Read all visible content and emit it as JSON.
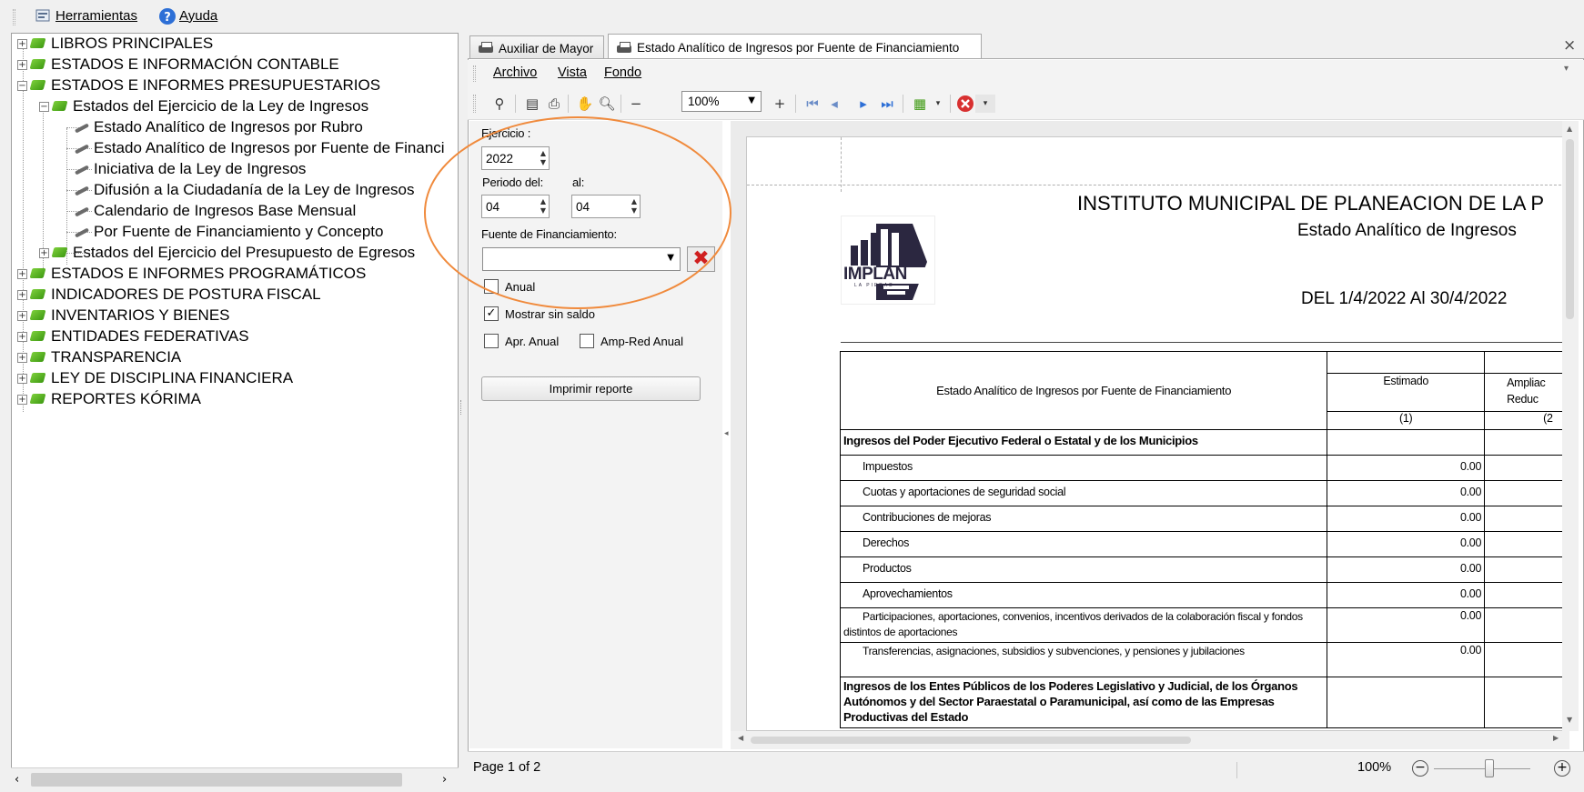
{
  "top_menu": {
    "tools": "Herramientas",
    "help": "Ayuda"
  },
  "tree": {
    "items": [
      {
        "label": "LIBROS PRINCIPALES"
      },
      {
        "label": "ESTADOS E INFORMACIÓN CONTABLE"
      },
      {
        "label": "ESTADOS E INFORMES PRESUPUESTARIOS"
      },
      {
        "label": "Estados del Ejercicio de la Ley de Ingresos"
      },
      {
        "label": "Estado Analítico de Ingresos por Rubro"
      },
      {
        "label": "Estado Analítico de Ingresos por Fuente de Financi"
      },
      {
        "label": "Iniciativa de la Ley de Ingresos"
      },
      {
        "label": "Difusión a la Ciudadanía de la Ley de Ingresos"
      },
      {
        "label": "Calendario de Ingresos Base Mensual"
      },
      {
        "label": "Por Fuente de Financiamiento y Concepto"
      },
      {
        "label": "Estados del Ejercicio del Presupuesto de Egresos"
      },
      {
        "label": "ESTADOS E INFORMES PROGRAMÁTICOS"
      },
      {
        "label": "INDICADORES DE POSTURA FISCAL"
      },
      {
        "label": "INVENTARIOS Y BIENES"
      },
      {
        "label": "ENTIDADES FEDERATIVAS"
      },
      {
        "label": "TRANSPARENCIA"
      },
      {
        "label": "LEY DE DISCIPLINA FINANCIERA"
      },
      {
        "label": "REPORTES KÓRIMA"
      }
    ]
  },
  "tabs": [
    {
      "label": "Auxiliar de Mayor"
    },
    {
      "label": "Estado Analítico de Ingresos por Fuente de Financiamiento"
    }
  ],
  "doc_menu": {
    "file": "Archivo",
    "view": "Vista",
    "bg": "Fondo"
  },
  "toolbar": {
    "zoom": "100%"
  },
  "params": {
    "ejercicio_label": "Ejercicio :",
    "ejercicio": "2022",
    "periodo_label": "Periodo del:",
    "al_label": "al:",
    "periodo_del": "04",
    "periodo_al": "04",
    "fuente_label": "Fuente de Financiamiento:",
    "fuente_value": "",
    "anual": "Anual",
    "mostrar": "Mostrar sin saldo",
    "apr_anual": "Apr. Anual",
    "amp_anual": "Amp-Red Anual",
    "print": "Imprimir reporte"
  },
  "report": {
    "institute": "INSTITUTO MUNICIPAL DE PLANEACION DE LA P",
    "subtitle": "Estado Analítico de Ingresos",
    "period": "DEL 1/4/2022 Al 30/4/2022",
    "logo_text": "IMPLAN",
    "logo_sub": "LA PIEDAD",
    "table": {
      "header_title": "Estado Analítico de Ingresos por Fuente de Financiamiento",
      "col1": "Estimado",
      "col1_num": "(1)",
      "col2a": "Ampliac",
      "col2b": "Reduc",
      "col2_num": "(2",
      "section1": "Ingresos del Poder Ejecutivo Federal o Estatal y de los Municipios",
      "rows": [
        {
          "label": "Impuestos",
          "value": "0.00"
        },
        {
          "label": "Cuotas y aportaciones de seguridad social",
          "value": "0.00"
        },
        {
          "label": "Contribuciones de mejoras",
          "value": "0.00"
        },
        {
          "label": "Derechos",
          "value": "0.00"
        },
        {
          "label": "Productos",
          "value": "0.00"
        },
        {
          "label": "Aprovechamientos",
          "value": "0.00"
        },
        {
          "label": "Participaciones, aportaciones, convenios, incentivos derivados de la colaboración fiscal y fondos distintos de aportaciones",
          "value": "0.00"
        },
        {
          "label": "Transferencias, asignaciones, subsidios y subvenciones, y pensiones y jubilaciones",
          "value": "0.00"
        }
      ],
      "section2": "Ingresos de los Entes Públicos de los Poderes Legislativo y Judicial, de los Órganos Autónomos y del Sector Paraestatal o Paramunicipal, así como de las Empresas Productivas del Estado"
    }
  },
  "status": {
    "page": "Page 1 of 2",
    "zoom": "100%"
  },
  "colors": {
    "accent_orange": "#f08a3c",
    "tree_book_green": "#3e9a12",
    "clear_red": "#d02020"
  }
}
